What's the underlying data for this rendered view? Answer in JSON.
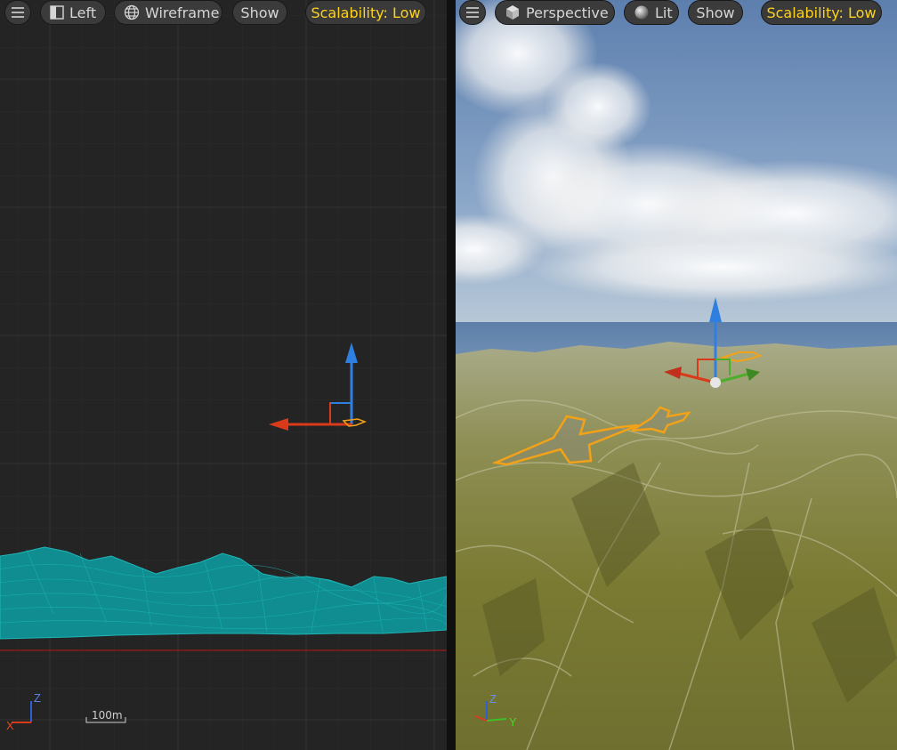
{
  "left_viewport": {
    "toolbar": {
      "view_label": "Left",
      "view_mode_label": "Wireframe",
      "show_label": "Show",
      "scalability_label": "Scalability: Low"
    },
    "axis_labels": {
      "x": "X",
      "z": "Z"
    },
    "scale_label": "100m"
  },
  "right_viewport": {
    "toolbar": {
      "view_label": "Perspective",
      "lit_label": "Lit",
      "show_label": "Show",
      "scalability_label": "Scalability: Low"
    },
    "axis_labels": {
      "y": "Y",
      "z": "Z"
    }
  },
  "colors": {
    "toolbar_bg": "#3b3b3b",
    "scalability_text": "#ffd21a",
    "wireframe": "#1aa3a6",
    "axis_x": "#d93a1a",
    "axis_y": "#4cae2a",
    "axis_z": "#2f7fe0",
    "selection": "#f2a218"
  }
}
